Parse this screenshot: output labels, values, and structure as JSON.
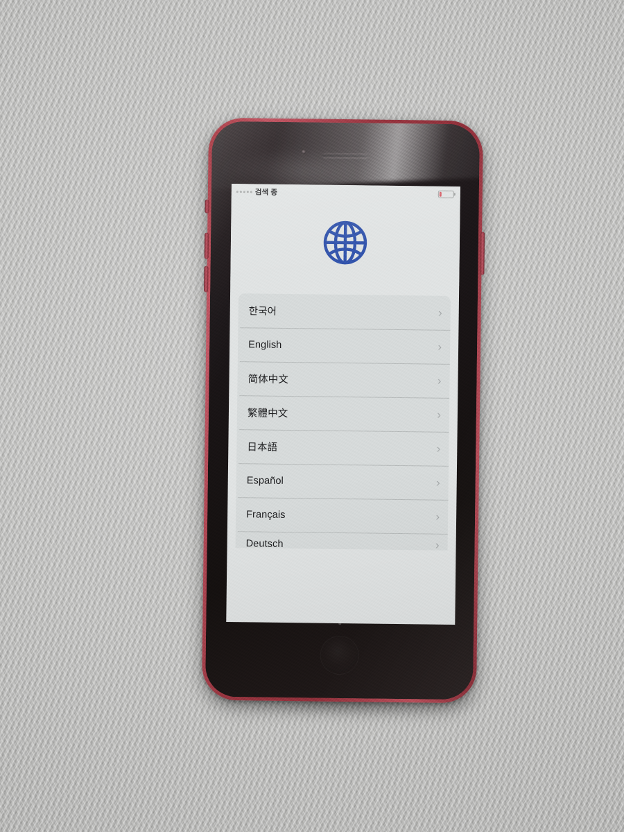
{
  "scene": {
    "description": "photo-of-phone-on-textured-gray-wall",
    "background_color": "#b9b9b7",
    "phone_body_color": "#a8424a",
    "phone_glass_color": "#1a1517"
  },
  "status_bar": {
    "signal_icon": "signal-dots-icon",
    "carrier_text": "검색 중",
    "battery_icon": "battery-low-icon",
    "battery_fill_color": "#d45a63",
    "battery_level_percent": 15
  },
  "setup_screen": {
    "hero_icon": "globe-icon",
    "hero_icon_color": "#2e4fa8",
    "screen_background": "#dfe2e2",
    "list_background": "#d5d9d9",
    "chevron_glyph": "›",
    "languages": [
      {
        "label": "한국어",
        "chevron": "›",
        "clipped": false
      },
      {
        "label": "English",
        "chevron": "›",
        "clipped": false
      },
      {
        "label": "简体中文",
        "chevron": "›",
        "clipped": false
      },
      {
        "label": "繁體中文",
        "chevron": "›",
        "clipped": false
      },
      {
        "label": "日本語",
        "chevron": "›",
        "clipped": false
      },
      {
        "label": "Español",
        "chevron": "›",
        "clipped": false
      },
      {
        "label": "Français",
        "chevron": "›",
        "clipped": false
      },
      {
        "label": "Deutsch",
        "chevron": "›",
        "clipped": true
      }
    ]
  },
  "hardware": {
    "earpiece": "earpiece-speaker",
    "front_camera": "front-camera",
    "home_button": "home-button",
    "mute_switch": "mute-switch",
    "volume_up": "volume-up-button",
    "volume_down": "volume-down-button",
    "power_button": "power-button"
  }
}
